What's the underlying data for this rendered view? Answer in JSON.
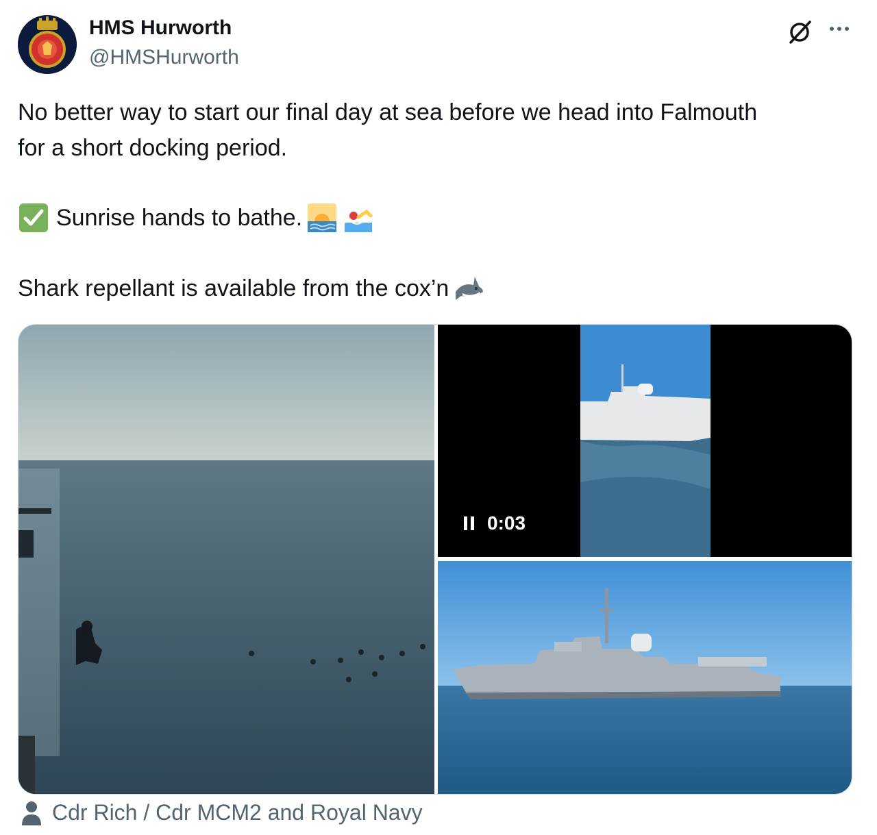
{
  "author": {
    "display_name": "HMS Hurworth",
    "handle": "@HMSHurworth",
    "avatar_icon": "ship-crest-icon"
  },
  "header_actions": {
    "grok_icon": "grok-icon",
    "more_icon": "more-icon"
  },
  "tweet": {
    "line1": "No better way to start our final day at sea before we head into Falmouth",
    "line2": "for a short docking period.",
    "line3": "Sunrise hands to bathe.",
    "line4": "Shark repellant is available from the cox’n",
    "emojis": [
      "check-mark-emoji",
      "sunrise-emoji",
      "swimmer-emoji",
      "shark-emoji"
    ]
  },
  "media": {
    "video_timer": "0:03"
  },
  "attribution": {
    "text": "Cdr Rich / Cdr MCM2 and Royal Navy"
  },
  "colors": {
    "text": "#0f1419",
    "secondary": "#536471",
    "check_green": "#78b159"
  }
}
